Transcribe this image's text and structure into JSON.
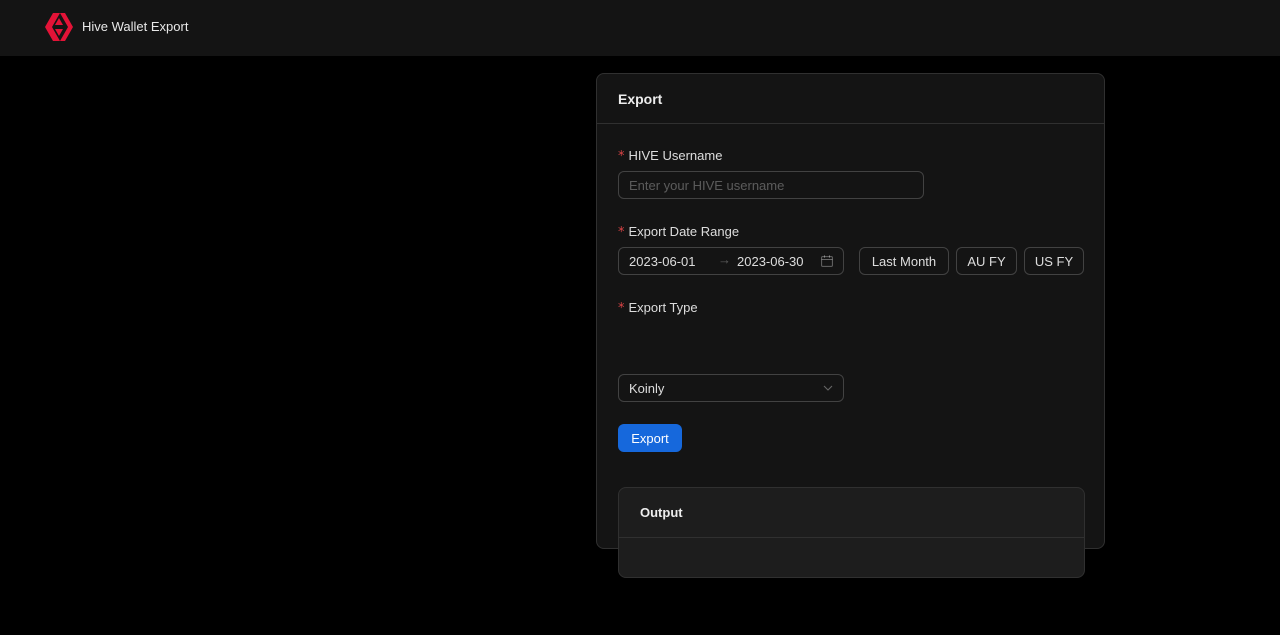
{
  "header": {
    "app_title": "Hive Wallet Export"
  },
  "export_card": {
    "title": "Export",
    "username": {
      "label": "HIVE Username",
      "required_mark": "*",
      "value": "",
      "placeholder": "Enter your HIVE username"
    },
    "date_range": {
      "label": "Export Date Range",
      "required_mark": "*",
      "start": "2023-06-01",
      "separator": "→",
      "end": "2023-06-30",
      "presets": [
        "Last Month",
        "AU FY",
        "US FY"
      ]
    },
    "export_type": {
      "label": "Export Type",
      "required_mark": "*",
      "selected": "Koinly"
    },
    "export_button": "Export"
  },
  "output_card": {
    "title": "Output",
    "content": ""
  },
  "colors": {
    "primary": "#1668dc",
    "required": "#dc4446",
    "logo": "#e31337"
  }
}
